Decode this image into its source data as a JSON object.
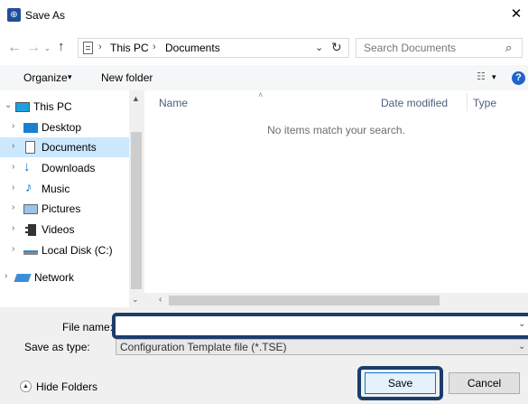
{
  "window": {
    "title": "Save As",
    "close_glyph": "✕",
    "app_icon": "globe-icon"
  },
  "address": {
    "back_glyph": "←",
    "forward_glyph": "→",
    "recent_glyph": "⌄",
    "up_glyph": "↑",
    "sep": "›",
    "crumbs": [
      "This PC",
      "Documents"
    ],
    "dropdown_glyph": "⌄",
    "refresh_glyph": "↻"
  },
  "search": {
    "placeholder": "Search Documents",
    "icon_glyph": "⌕"
  },
  "toolbar": {
    "organize_label": "Organize",
    "new_folder_label": "New folder",
    "caret": "▾",
    "views_glyph": "☷",
    "help_glyph": "?"
  },
  "nav": {
    "items": [
      {
        "label": "This PC",
        "chevron": "⌄",
        "icon": "computer-icon"
      },
      {
        "label": "Desktop",
        "chevron": "›",
        "icon": "desktop-folder-icon"
      },
      {
        "label": "Documents",
        "chevron": "›",
        "icon": "documents-folder-icon",
        "selected": true
      },
      {
        "label": "Downloads",
        "chevron": "›",
        "icon": "downloads-folder-icon"
      },
      {
        "label": "Music",
        "chevron": "›",
        "icon": "music-folder-icon"
      },
      {
        "label": "Pictures",
        "chevron": "›",
        "icon": "pictures-folder-icon"
      },
      {
        "label": "Videos",
        "chevron": "›",
        "icon": "videos-folder-icon"
      },
      {
        "label": "Local Disk (C:)",
        "chevron": "›",
        "icon": "local-disk-icon"
      },
      {
        "label": "Network",
        "chevron": "›",
        "icon": "network-icon"
      }
    ],
    "scroll_up": "▲",
    "scroll_down": "⌄"
  },
  "content": {
    "columns": {
      "name": "Name",
      "date": "Date modified",
      "type": "Type"
    },
    "sort_glyph": "˄",
    "empty_message": "No items match your search.",
    "hscroll_left": "‹"
  },
  "form": {
    "file_name_label": "File name:",
    "file_name_value": "",
    "save_type_label": "Save as type:",
    "save_type_value": "Configuration Template file (*.TSE)",
    "dropdown_glyph": "⌄"
  },
  "footer": {
    "hide_folders_label": "Hide Folders",
    "hide_glyph": "▲",
    "save_label": "Save",
    "cancel_label": "Cancel"
  },
  "colors": {
    "accent": "#1c3d6b",
    "selection": "#cce8ff",
    "help": "#1e64c8"
  }
}
